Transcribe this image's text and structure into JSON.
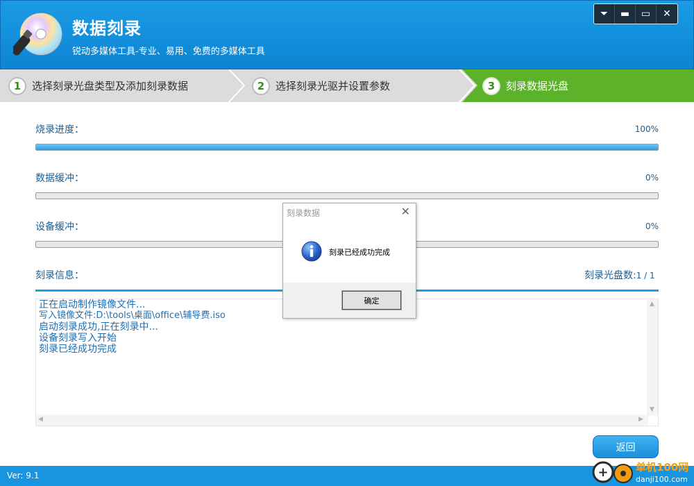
{
  "header": {
    "title": "数据刻录",
    "subtitle": "锐动多媒体工具-专业、易用、免费的多媒体工具",
    "window_controls": [
      "menu-icon",
      "minimize-icon",
      "maximize-icon",
      "close-icon"
    ],
    "window_control_glyphs": {
      "menu": "⏷",
      "minimize": "▬",
      "maximize": "▭",
      "close": "✕"
    }
  },
  "steps": [
    {
      "num": "1",
      "label": "选择刻录光盘类型及添加刻录数据",
      "state": "done"
    },
    {
      "num": "2",
      "label": "选择刻录光驱并设置参数",
      "state": "done"
    },
    {
      "num": "3",
      "label": "刻录数据光盘",
      "state": "active"
    }
  ],
  "progress": {
    "burn": {
      "label": "烧录进度：",
      "value": "100%",
      "fraction": 1.0
    },
    "data_buffer": {
      "label": "数据缓冲：",
      "value": "0%",
      "fraction": 0.0
    },
    "device_buffer": {
      "label": "设备缓冲：",
      "value": "0%",
      "fraction": 0.0
    }
  },
  "info": {
    "label": "刻录信息：",
    "disc_count_label": "刻录光盘数:",
    "disc_count": "1 / 1",
    "log": [
      "正在启动制作镜像文件...",
      "写入镜像文件:D:\\tools\\桌面\\office\\辅导费.iso",
      "启动刻录成功,正在刻录中...",
      "设备刻录写入开始",
      "刻录已经成功完成"
    ]
  },
  "buttons": {
    "return": "返回"
  },
  "status": {
    "version": "Ver: 9.1"
  },
  "dialog": {
    "title": "刻录数据",
    "message": "刻录已经成功完成",
    "ok": "确定",
    "icon": "info-icon"
  },
  "watermark": {
    "text": "单机100网",
    "url": "danji100.com"
  },
  "colors": {
    "header_blue": "#138fdc",
    "step_active_green": "#5cb32a",
    "progress_blue": "#279ee6",
    "text_blue": "#1f5f91"
  }
}
